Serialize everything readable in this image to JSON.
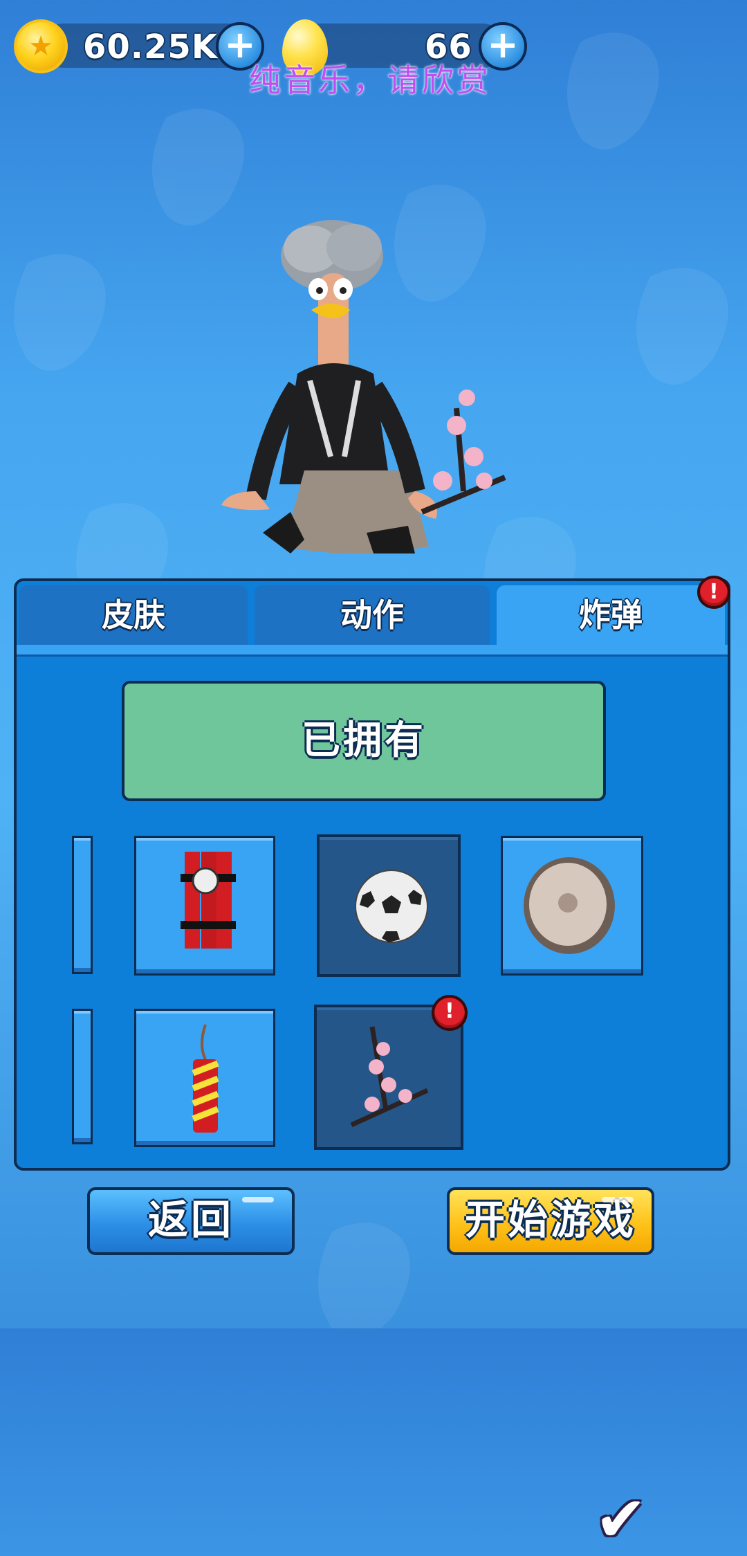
{
  "currency": {
    "coins": "60.25K",
    "gems": "66",
    "coin_icon": "coin-icon",
    "gem_icon": "gem-icon",
    "plus_symbol": "+"
  },
  "overlay_text": "纯音乐，请欣赏",
  "tabs": [
    {
      "label": "皮肤",
      "active": false
    },
    {
      "label": "动作",
      "active": false
    },
    {
      "label": "炸弹",
      "active": true,
      "alert": true
    }
  ],
  "owned_label": "已拥有",
  "alert_symbol": "!",
  "items": [
    {
      "name": "dynamite-bundle",
      "selected": false
    },
    {
      "name": "soccer-ball",
      "selected": false,
      "highlighted": true
    },
    {
      "name": "gong",
      "selected": true
    },
    {
      "name": "firecracker",
      "selected": false
    },
    {
      "name": "cherry-blossom-branch",
      "selected": false,
      "highlighted": true,
      "alert": true
    }
  ],
  "buttons": {
    "back": "返回",
    "start": "开始游戏"
  },
  "colors": {
    "panel": "#0e7fd8",
    "tab_active": "#3aa4f4",
    "owned_bg": "#6fc69a",
    "start_btn": "#ffc21a",
    "alert": "#e0202a"
  }
}
